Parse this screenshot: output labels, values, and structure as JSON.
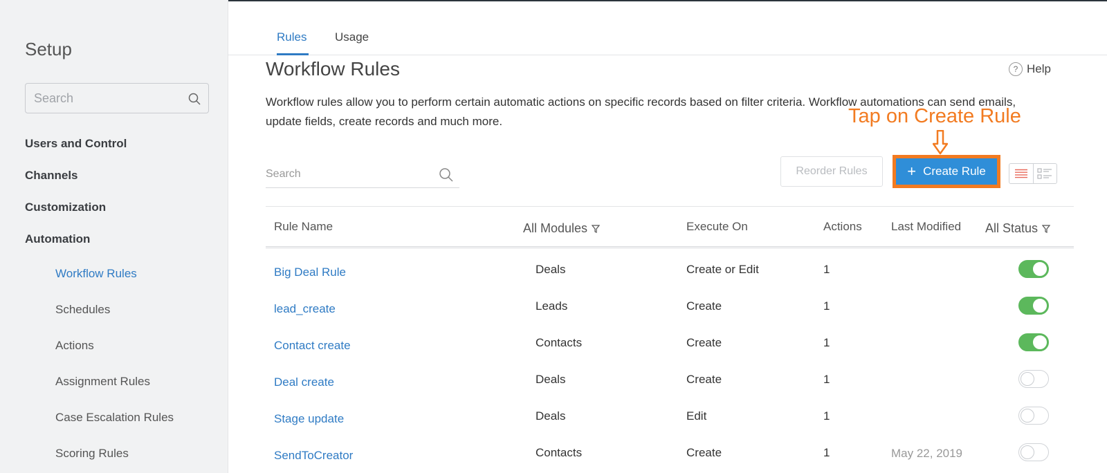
{
  "sidebar": {
    "title": "Setup",
    "search_placeholder": "Search",
    "sections": [
      {
        "label": "Users and Control"
      },
      {
        "label": "Channels"
      },
      {
        "label": "Customization"
      },
      {
        "label": "Automation"
      }
    ],
    "automation_items": [
      {
        "label": "Workflow Rules",
        "active": true
      },
      {
        "label": "Schedules"
      },
      {
        "label": "Actions"
      },
      {
        "label": "Assignment Rules"
      },
      {
        "label": "Case Escalation Rules"
      },
      {
        "label": "Scoring Rules"
      }
    ]
  },
  "tabs": [
    {
      "label": "Rules",
      "active": true
    },
    {
      "label": "Usage"
    }
  ],
  "page": {
    "title": "Workflow Rules",
    "help_label": "Help",
    "description": "Workflow rules allow you to perform certain automatic actions on specific records based on filter criteria. Workflow automations can send emails, update fields, create records and much more."
  },
  "annotation": {
    "text": "Tap on Create Rule",
    "color": "#f27b21"
  },
  "toolbar": {
    "search_placeholder": "Search",
    "reorder_label": "Reorder Rules",
    "create_label": "Create Rule",
    "create_icon": "plus-icon"
  },
  "table": {
    "headers": {
      "rule_name": "Rule Name",
      "modules": "All Modules",
      "execute_on": "Execute On",
      "actions": "Actions",
      "last_modified": "Last Modified",
      "status": "All Status"
    },
    "rows": [
      {
        "name": "Big Deal Rule",
        "module": "Deals",
        "execute": "Create or Edit",
        "actions": "1",
        "modified": "",
        "enabled": true
      },
      {
        "name": "lead_create",
        "module": "Leads",
        "execute": "Create",
        "actions": "1",
        "modified": "",
        "enabled": true
      },
      {
        "name": "Contact create",
        "module": "Contacts",
        "execute": "Create",
        "actions": "1",
        "modified": "",
        "enabled": true
      },
      {
        "name": "Deal create",
        "module": "Deals",
        "execute": "Create",
        "actions": "1",
        "modified": "",
        "enabled": false
      },
      {
        "name": "Stage update",
        "module": "Deals",
        "execute": "Edit",
        "actions": "1",
        "modified": "",
        "enabled": false
      },
      {
        "name": "SendToCreator",
        "module": "Contacts",
        "execute": "Create",
        "actions": "1",
        "modified": "May 22, 2019",
        "enabled": false
      }
    ]
  },
  "colors": {
    "accent": "#2f7bc4",
    "button": "#2f8ed8",
    "toggle_on": "#5cb85c",
    "highlight": "#f27b21"
  }
}
